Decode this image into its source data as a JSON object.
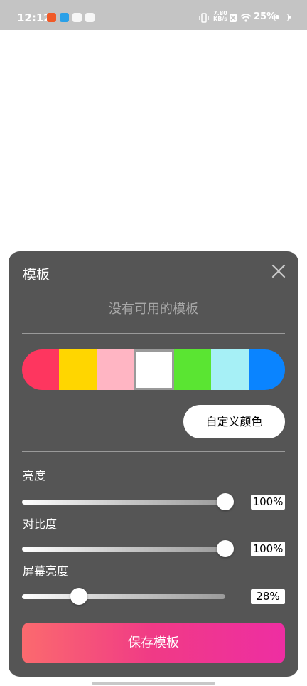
{
  "status_bar": {
    "time": "12:12",
    "network_speed_value": "7.80",
    "network_speed_unit": "KB/s",
    "battery_text": "25%",
    "battery_level": 0.25
  },
  "dialog": {
    "title": "模板",
    "empty_text": "没有可用的模板",
    "swatch_colors": [
      "#fe365f",
      "#ffd600",
      "#ffb5c3",
      "#ffffff",
      "#5ae532",
      "#a6f0f6",
      "#0a84ff"
    ],
    "selected_swatch": 3,
    "custom_color_label": "自定义颜色",
    "sliders": [
      {
        "label": "亮度",
        "value_text": "100%",
        "value": 1.0
      },
      {
        "label": "对比度",
        "value_text": "100%",
        "value": 1.0
      },
      {
        "label": "屏幕亮度",
        "value_text": "28%",
        "value": 0.28
      }
    ],
    "save_label": "保存模板"
  }
}
